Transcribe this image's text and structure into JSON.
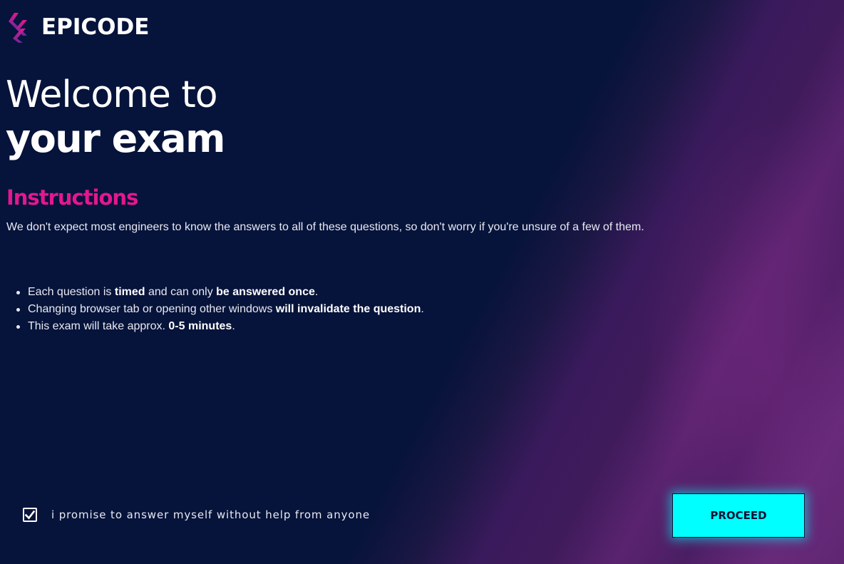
{
  "brand": {
    "name": "EPICODE",
    "icon": "epicode-logo-icon",
    "accent": "#e3178f"
  },
  "hero": {
    "line1": "Welcome to",
    "line2": "your exam"
  },
  "instructions": {
    "title": "Instructions",
    "intro": "We don't expect most engineers to know the answers to all of these questions, so don't worry if you're unsure of a few of them.",
    "rules": [
      {
        "text_before": "Each question is ",
        "bold1": "timed",
        "text_mid": " and can only ",
        "bold2": "be answered once",
        "text_after": "."
      },
      {
        "text_before": "Changing browser tab or opening other windows ",
        "bold1": "will invalidate the question",
        "text_after": "."
      },
      {
        "text_before": "This exam will take approx. ",
        "bold1": "0-5 minutes",
        "text_after": "."
      }
    ]
  },
  "promise": {
    "label": "i promise to answer myself without help from anyone",
    "checked": true,
    "icon": "checkmark-icon"
  },
  "proceed_button": {
    "label": "PROCEED",
    "color": "#00ffff"
  }
}
